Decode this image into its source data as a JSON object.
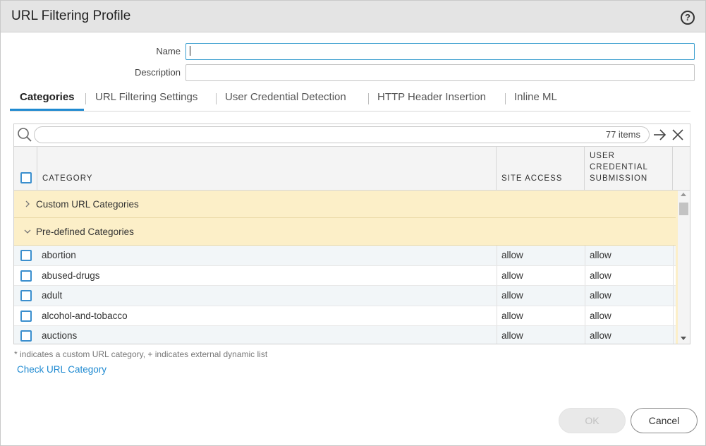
{
  "dialog": {
    "title": "URL Filtering Profile",
    "help_icon": "help-circle-icon",
    "help_glyph": "?"
  },
  "form": {
    "name_label": "Name",
    "name_value": "",
    "description_label": "Description",
    "description_value": ""
  },
  "tabs": [
    "Categories",
    "URL Filtering Settings",
    "User Credential Detection",
    "HTTP Header Insertion",
    "Inline ML"
  ],
  "active_tab": "Categories",
  "search": {
    "value": "",
    "items_count": "77 items",
    "search_icon": "search-icon",
    "go_icon": "arrow-right-icon",
    "clear_icon": "close-icon"
  },
  "table": {
    "columns": [
      "CATEGORY",
      "SITE ACCESS",
      "USER CREDENTIAL SUBMISSION"
    ],
    "column_lines": [
      "USER",
      "CREDENTIAL",
      "SUBMISSION"
    ],
    "groups": [
      {
        "label": "Custom URL Categories",
        "expanded": false
      },
      {
        "label": "Pre-defined Categories",
        "expanded": true
      }
    ],
    "rows": [
      {
        "category": "abortion",
        "site_access": "allow",
        "credential": "allow"
      },
      {
        "category": "abused-drugs",
        "site_access": "allow",
        "credential": "allow"
      },
      {
        "category": "adult",
        "site_access": "allow",
        "credential": "allow"
      },
      {
        "category": "alcohol-and-tobacco",
        "site_access": "allow",
        "credential": "allow"
      },
      {
        "category": "auctions",
        "site_access": "allow",
        "credential": "allow"
      }
    ]
  },
  "footnote": "* indicates a custom URL category, + indicates external dynamic list",
  "check_link": "Check URL Category",
  "buttons": {
    "ok": "OK",
    "cancel": "Cancel",
    "ok_enabled": false
  },
  "colors": {
    "accent": "#1f8ad1",
    "group_bg": "#fcefc8",
    "titlebar_bg": "#e4e4e4"
  }
}
